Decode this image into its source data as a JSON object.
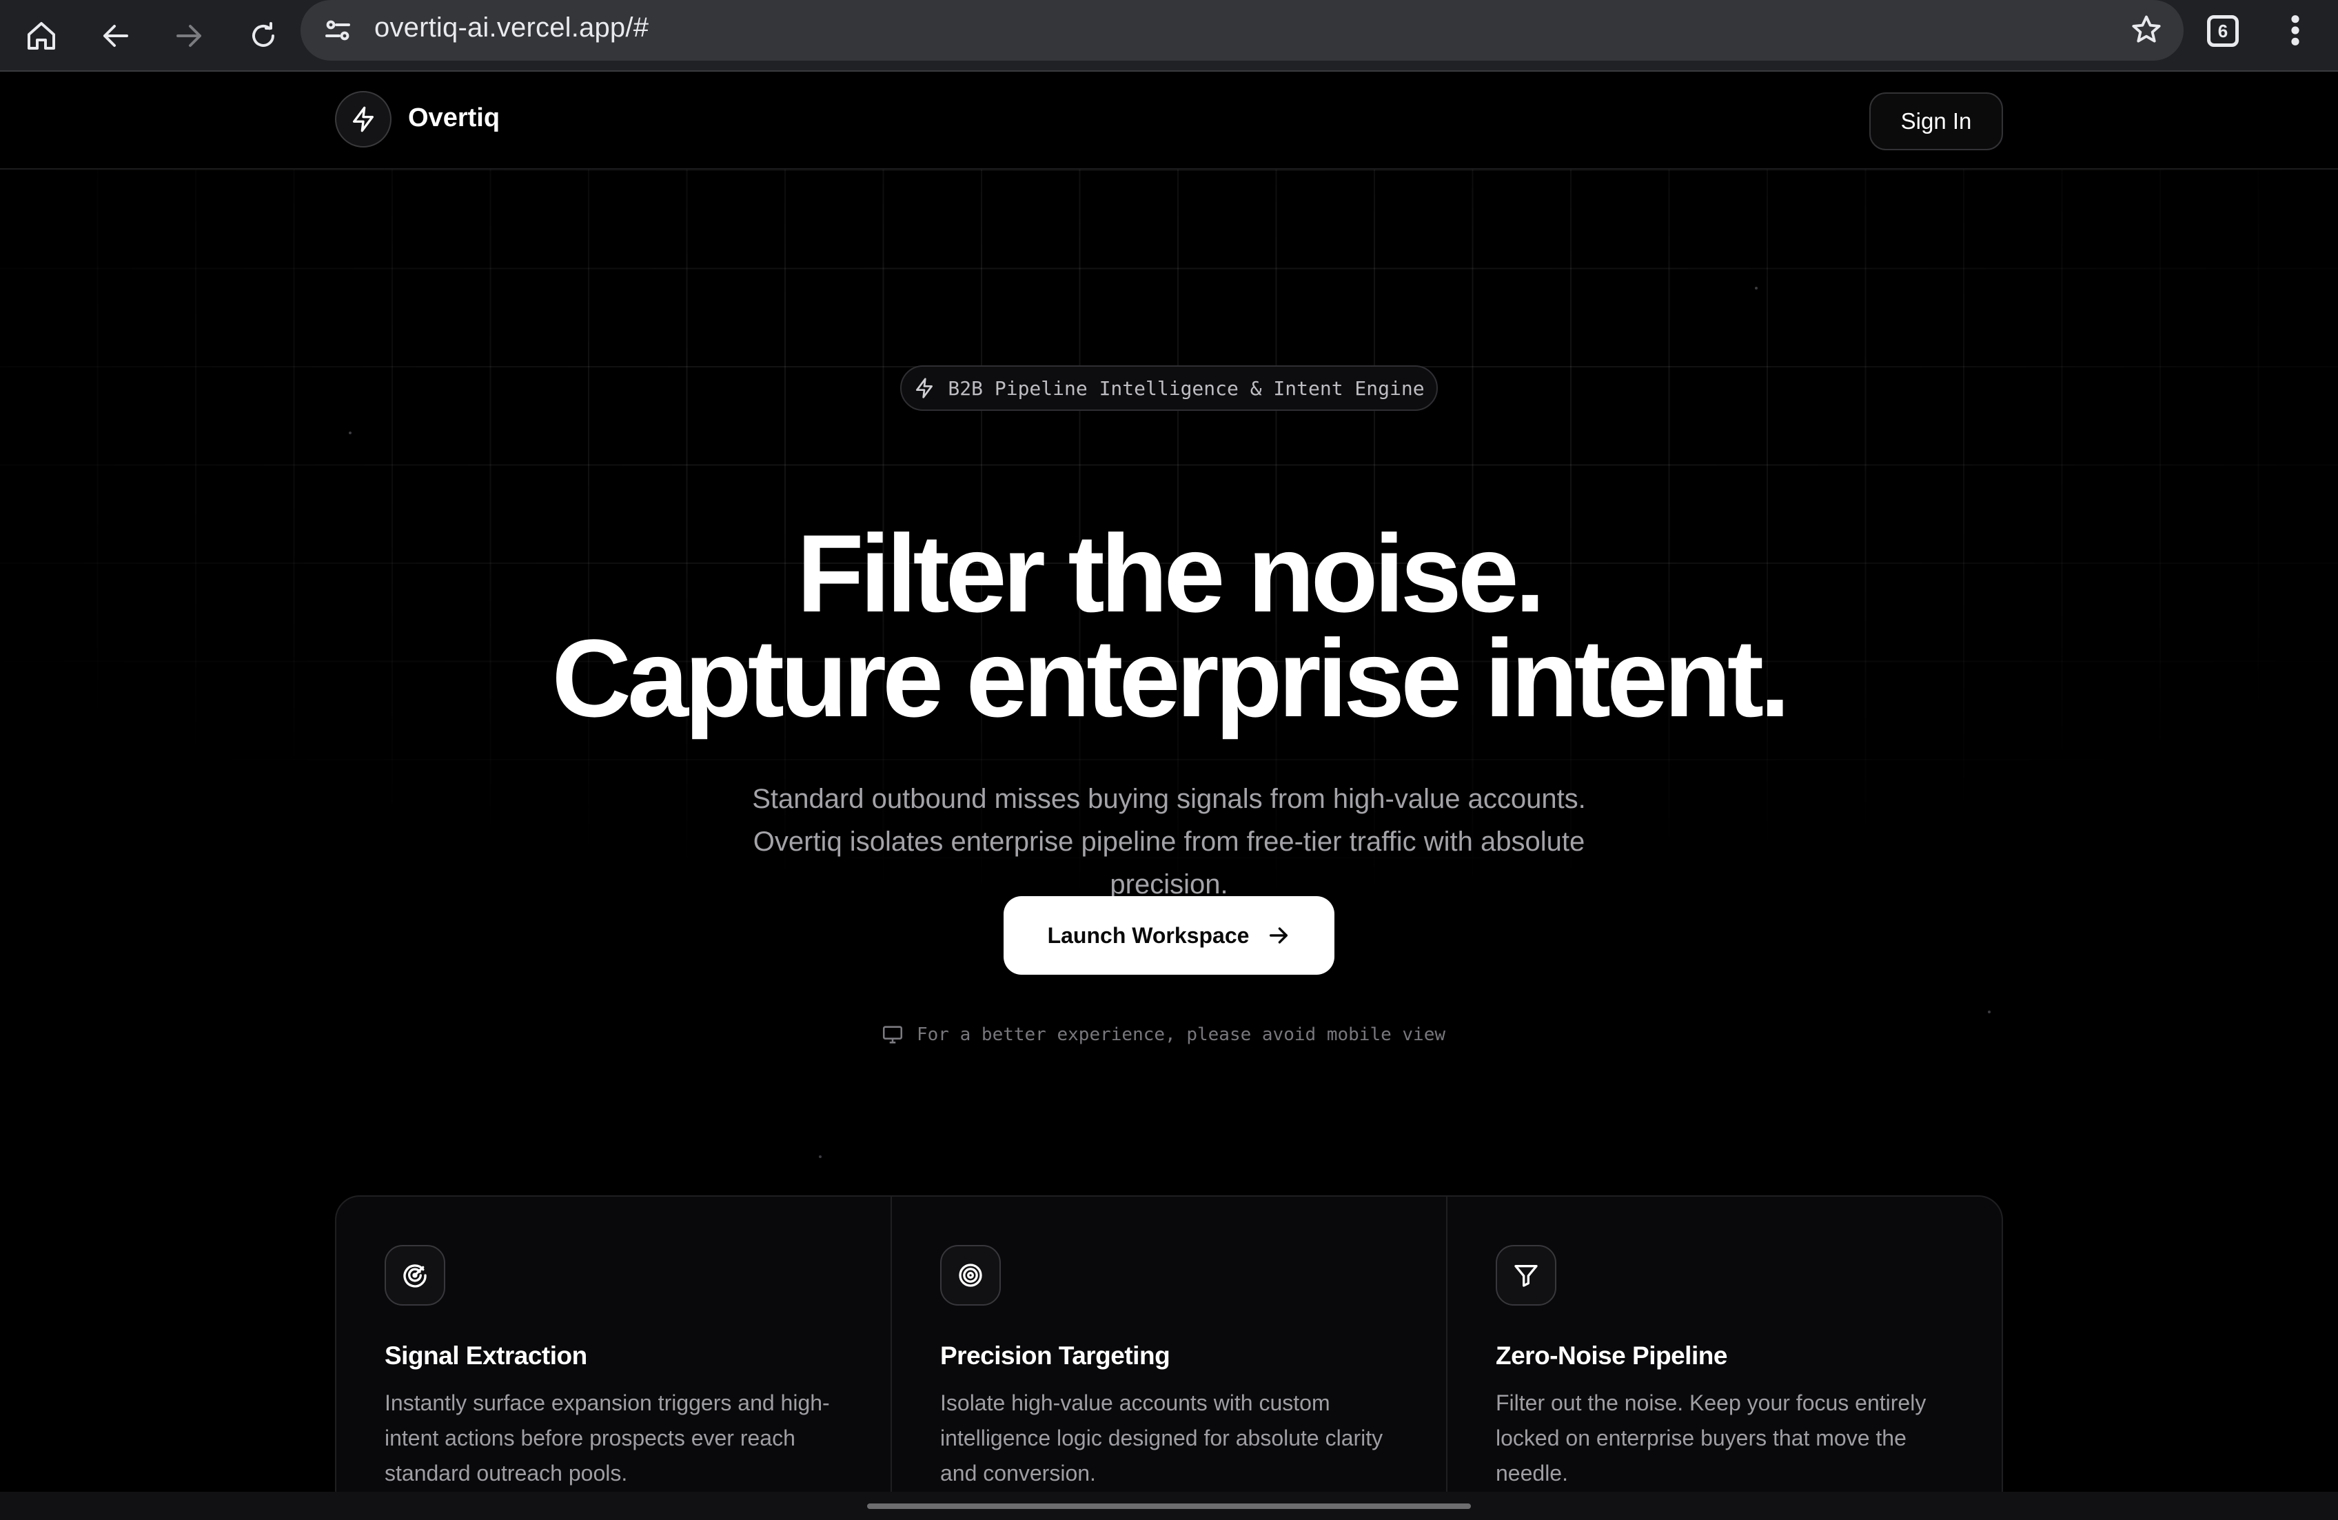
{
  "browser": {
    "url": "overtiq-ai.vercel.app/#",
    "tab_count": "6",
    "icons": [
      "home-icon",
      "back-icon",
      "forward-icon",
      "reload-icon",
      "site-settings-icon",
      "bookmark-star-icon",
      "menu-dots-icon"
    ]
  },
  "nav": {
    "brand": "Overtiq",
    "sign_in": "Sign In",
    "logo_icon": "lightning-bolt-icon"
  },
  "hero": {
    "pill": "B2B Pipeline Intelligence & Intent Engine",
    "headline_line1": "Filter the noise.",
    "headline_line2": "Capture enterprise intent.",
    "subtext": "Standard outbound misses buying signals from high-value accounts. Overtiq isolates enterprise pipeline from free-tier traffic with absolute precision.",
    "cta": "Launch Workspace",
    "mobile_note": "For a better experience, please avoid mobile view"
  },
  "features": [
    {
      "icon": "radar-icon",
      "title": "Signal Extraction",
      "desc": "Instantly surface expansion triggers and high-intent actions before prospects ever reach standard outreach pools."
    },
    {
      "icon": "target-icon",
      "title": "Precision Targeting",
      "desc": "Isolate high-value accounts with custom intelligence logic designed for absolute clarity and conversion."
    },
    {
      "icon": "funnel-icon",
      "title": "Zero-Noise Pipeline",
      "desc": "Filter out the noise. Keep your focus entirely locked on enterprise buyers that move the needle."
    }
  ],
  "colors": {
    "background": "#000000",
    "text": "#ffffff",
    "muted": "#a3a3a8",
    "chrome": "#202124"
  }
}
